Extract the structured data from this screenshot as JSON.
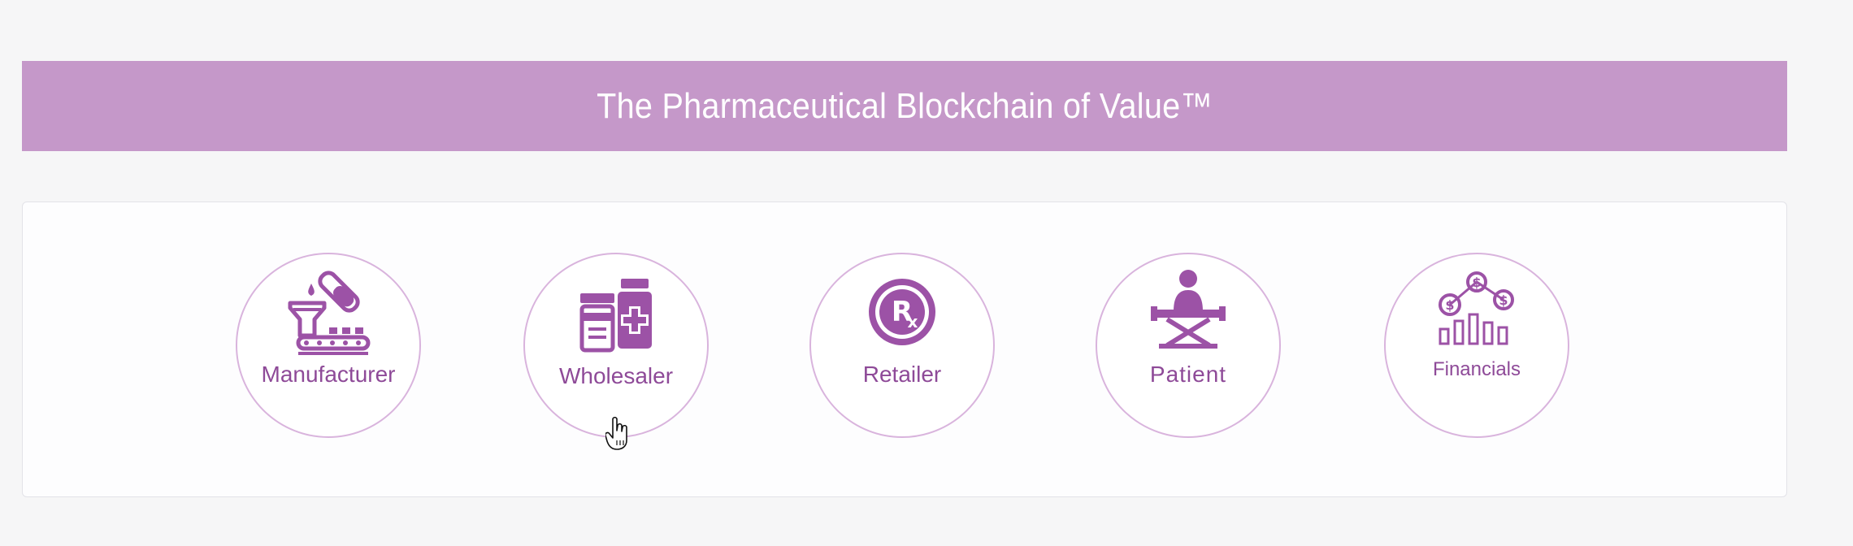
{
  "banner": {
    "title": "The Pharmaceutical Blockchain of Value™"
  },
  "stages": [
    {
      "label": "Manufacturer",
      "icon": "manufacturing-icon"
    },
    {
      "label": "Wholesaler",
      "icon": "medicine-bottles-icon"
    },
    {
      "label": "Retailer",
      "icon": "rx-icon"
    },
    {
      "label": "Patient",
      "icon": "patient-bed-icon"
    },
    {
      "label": "Financials",
      "icon": "financial-chart-icon"
    }
  ],
  "colors": {
    "banner_bg": "#c598c9",
    "icon_purple": "#9c52a6",
    "label_purple": "#8e4a98",
    "circle_border": "#d9b4dd",
    "page_bg": "#f6f6f7"
  }
}
